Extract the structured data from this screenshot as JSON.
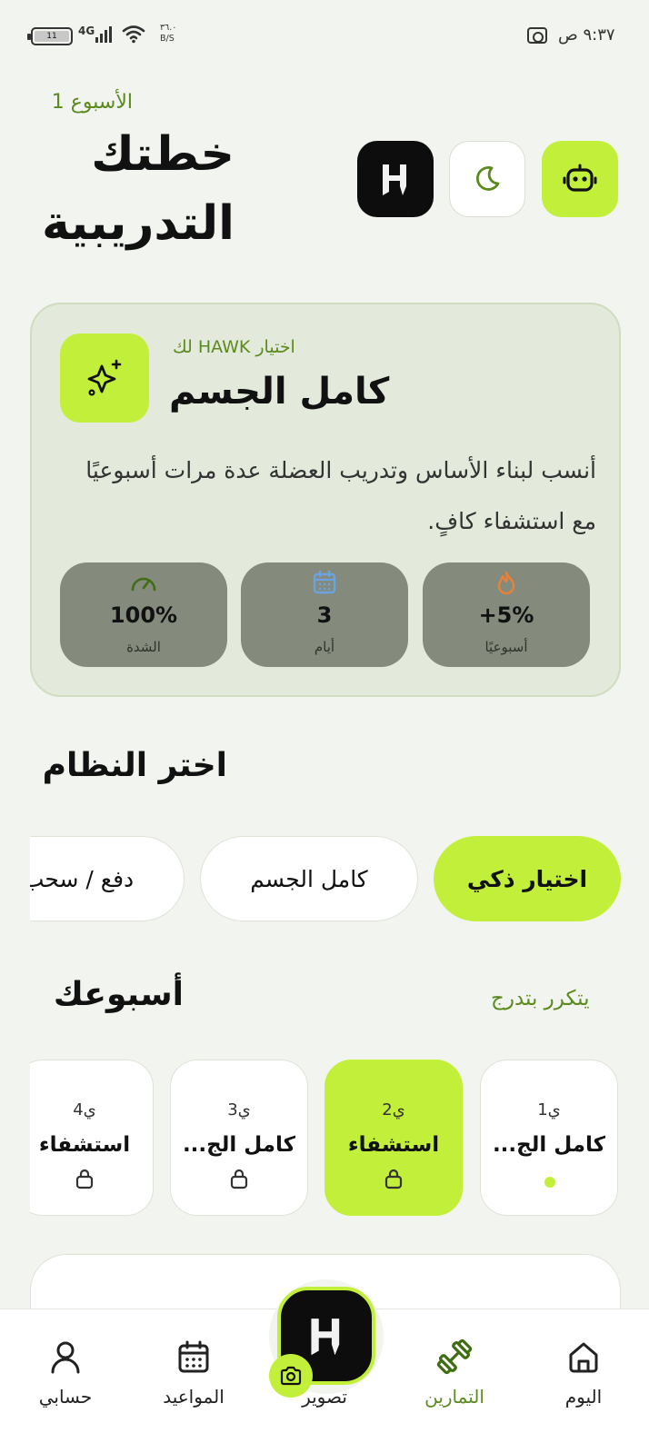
{
  "status_bar": {
    "time": "٩:٣٧",
    "am_pm": "ص",
    "network": "4G",
    "speed_value": "٣٦.٠",
    "speed_unit": "B/S",
    "battery": "11"
  },
  "header": {
    "week_label": "الأسبوع 1",
    "title": "خطتك التدريبية",
    "buttons": [
      "robot-icon",
      "moon-icon",
      "hawk-logo"
    ]
  },
  "plan_card": {
    "subtitle": "اختيار HAWK لك",
    "name": "كامل الجسم",
    "description": "أنسب لبناء الأساس وتدريب العضلة عدة مرات أسبوعيًا مع استشفاء كافٍ.",
    "stats": [
      {
        "icon": "flame-icon",
        "value": "+5%",
        "label": "أسبوعيًا"
      },
      {
        "icon": "calendar-icon",
        "value": "3",
        "label": "أيام"
      },
      {
        "icon": "gauge-icon",
        "value": "100%",
        "label": "الشدة"
      }
    ]
  },
  "system_section": {
    "title": "اختر النظام",
    "chips": [
      "اختيار ذكي",
      "كامل الجسم",
      "دفع / سحب"
    ],
    "selected": "اختيار ذكي"
  },
  "week_section": {
    "title": "أسبوعك",
    "link": "يتكرر بتدرج",
    "days": [
      {
        "num": "ي1",
        "label": "كامل الج...",
        "state": "today"
      },
      {
        "num": "ي2",
        "label": "استشفاء",
        "state": "selected-locked"
      },
      {
        "num": "ي3",
        "label": "كامل الج...",
        "state": "locked"
      },
      {
        "num": "ي4",
        "label": "استشفاء",
        "state": "locked"
      }
    ]
  },
  "bottom_nav": {
    "items": [
      {
        "label": "اليوم",
        "icon": "home-icon"
      },
      {
        "label": "التمارين",
        "icon": "dumbbell-icon"
      },
      {
        "label": "تصوير",
        "icon": "camera-icon"
      },
      {
        "label": "المواعيد",
        "icon": "calendar-icon"
      },
      {
        "label": "حسابي",
        "icon": "user-icon"
      }
    ],
    "active": "التمارين"
  },
  "colors": {
    "accent": "#c2f03a",
    "accent_text": "#5b8a1e",
    "background": "#f2f4ef",
    "card": "#e3eadb",
    "stat_pill": "#848a7c"
  }
}
